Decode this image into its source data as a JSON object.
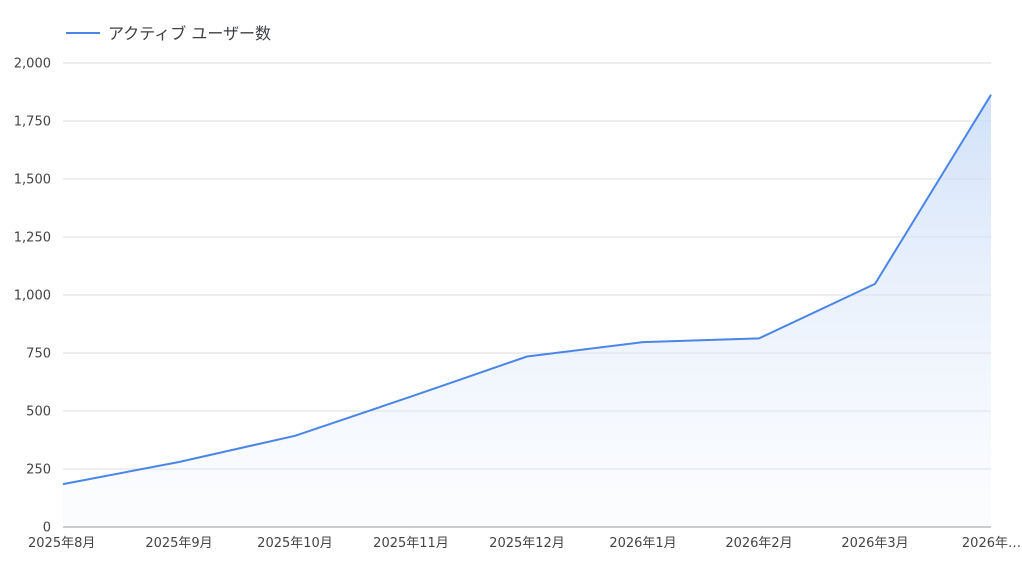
{
  "chart_data": {
    "type": "area",
    "legend": {
      "position": "top-left",
      "entries": [
        {
          "name": "アクティブ ユーザー数",
          "color": "#4a86e8"
        }
      ]
    },
    "categories": [
      "2025年8月",
      "2025年9月",
      "2025年10月",
      "2025年11月",
      "2025年12月",
      "2026年1月",
      "2026年2月",
      "2026年3月",
      "2026年…"
    ],
    "series": [
      {
        "name": "アクティブ ユーザー数",
        "color": "#4a86e8",
        "values": [
          185,
          280,
          393,
          562,
          735,
          797,
          813,
          1048,
          1863
        ]
      }
    ],
    "ylim": [
      0,
      2000
    ],
    "y_ticks": [
      0,
      250,
      500,
      750,
      1000,
      1250,
      1500,
      1750,
      2000
    ],
    "y_tick_labels": [
      "0",
      "250",
      "500",
      "750",
      "1,000",
      "1,250",
      "1,500",
      "1,750",
      "2,000"
    ],
    "grid": true,
    "xlabel": "",
    "ylabel": ""
  }
}
